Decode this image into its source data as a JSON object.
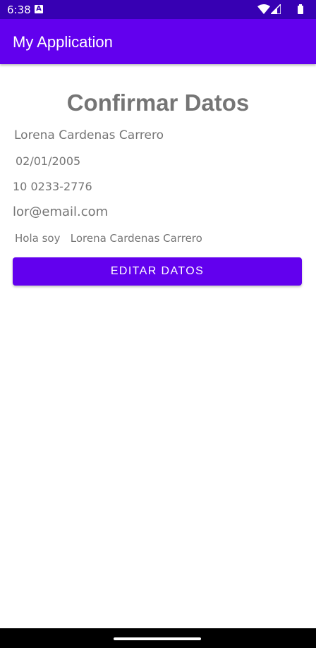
{
  "status_bar": {
    "time": "6:38",
    "notification_icon": "app-notification-icon",
    "notification_glyph": "A",
    "wifi_icon": "wifi-icon",
    "signal_icon": "cell-signal-icon",
    "battery_icon": "battery-icon"
  },
  "app_bar": {
    "title": "My Application"
  },
  "main": {
    "heading": "Confirmar Datos",
    "name": "Lorena Cardenas Carrero",
    "birth_date": "02/01/2005",
    "phone": "10 0233-2776",
    "email": "lor@email.com",
    "greeting": "Hola soy   Lorena Cardenas Carrero",
    "edit_button_label": "EDITAR DATOS"
  },
  "nav_bar": {
    "home_icon": "home-gesture-handle"
  },
  "colors": {
    "status_bar": "#3700b3",
    "primary": "#6200ee",
    "text_secondary": "#757575",
    "background": "#ffffff"
  }
}
